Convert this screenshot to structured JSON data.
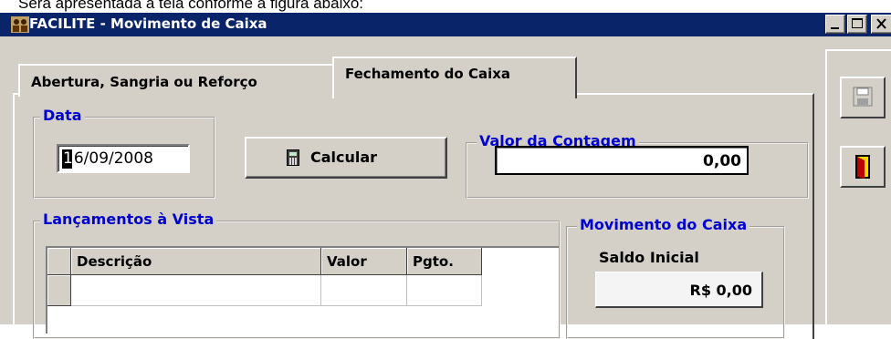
{
  "caption": "Será apresentada a tela conforme a figura abaixo:",
  "window": {
    "title": "FACILITE - Movimento de Caixa",
    "icon": "app-users-icon",
    "controls": [
      "minimize-icon",
      "maximize-icon",
      "close-icon"
    ]
  },
  "tabs": [
    {
      "label": "Abertura, Sangria ou Reforço",
      "active": false
    },
    {
      "label": "Fechamento do Caixa",
      "active": true
    }
  ],
  "data_group": {
    "legend": "Data",
    "date_first_char": "1",
    "date_rest": "6/09/2008"
  },
  "calcular_button": {
    "label": "Calcular",
    "icon": "calculator-icon"
  },
  "contagem_group": {
    "legend": "Valor da Contagem",
    "value": "0,00"
  },
  "lancamentos_group": {
    "legend": "Lançamentos à Vista",
    "columns": [
      "Descrição",
      "Valor",
      "Pgto."
    ],
    "rows": [
      [
        "",
        "",
        ""
      ]
    ]
  },
  "movimento_group": {
    "legend": "Movimento do Caixa",
    "saldo_label": "Saldo Inicial",
    "saldo_value": "R$ 0,00"
  },
  "toolbar": {
    "buttons": [
      "save-icon",
      "exit-door-icon"
    ]
  },
  "colors": {
    "titlebar": "#0a246a",
    "group_legend": "#0000d0",
    "face": "#d4d0c8"
  }
}
